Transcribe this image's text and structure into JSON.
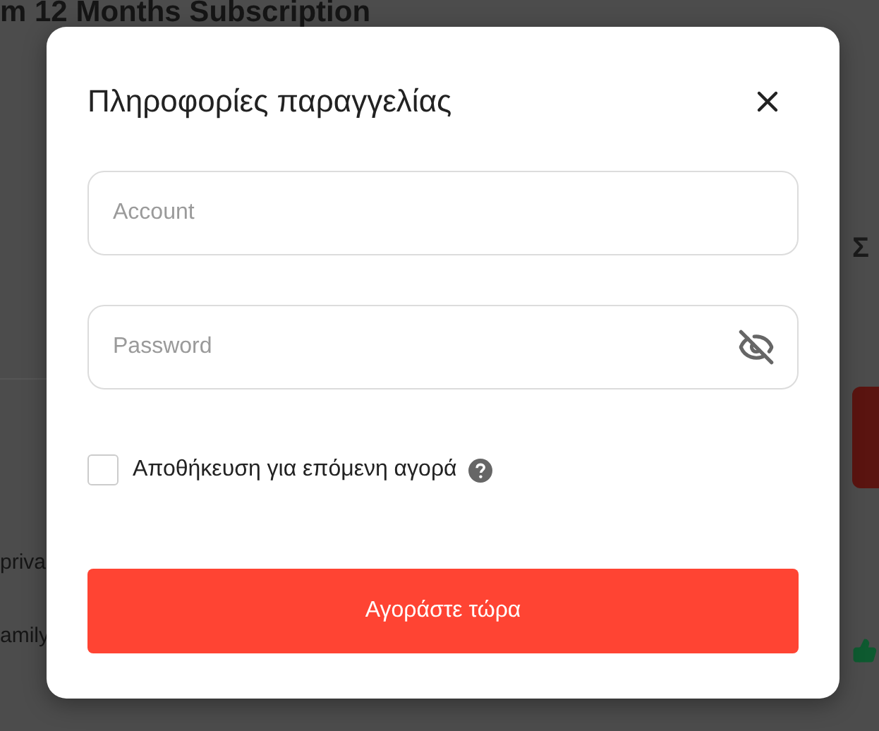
{
  "background": {
    "title": "m 12 Months Subscription",
    "side_heading": "Σ",
    "list": [
      "priva",
      "amily"
    ]
  },
  "dialog": {
    "title": "Πληροφορίες παραγγελίας",
    "fields": [
      {
        "kind": "text",
        "placeholder": "Account"
      },
      {
        "kind": "password",
        "placeholder": "Password"
      }
    ],
    "remember": {
      "label": "Αποθήκευση για επόμενη αγορά",
      "checked": false
    },
    "submit": "Αγοράστε τώρα"
  }
}
